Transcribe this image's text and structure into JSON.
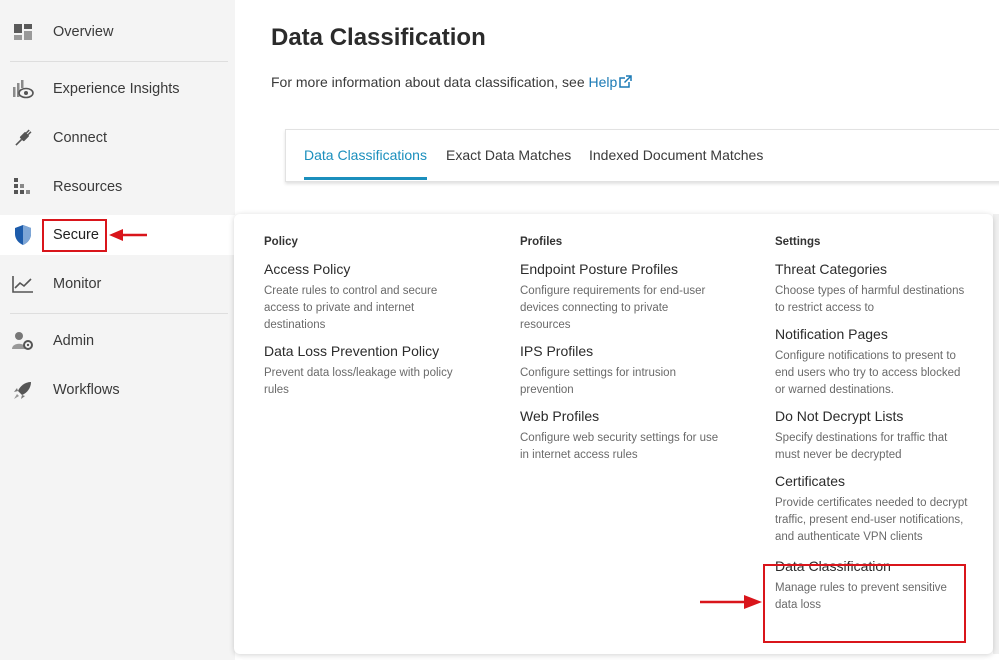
{
  "sidebar": {
    "items": [
      {
        "label": "Overview",
        "icon": "dashboard-icon"
      },
      {
        "label": "Experience Insights",
        "icon": "insights-eye-icon"
      },
      {
        "label": "Connect",
        "icon": "plug-icon"
      },
      {
        "label": "Resources",
        "icon": "resources-grid-icon"
      },
      {
        "label": "Secure",
        "icon": "shield-icon"
      },
      {
        "label": "Monitor",
        "icon": "line-chart-icon"
      },
      {
        "label": "Admin",
        "icon": "user-gear-icon"
      },
      {
        "label": "Workflows",
        "icon": "rocket-icon"
      }
    ],
    "active": "Secure"
  },
  "main": {
    "title": "Data Classification",
    "info_text": "For more information about data classification, see ",
    "help_label": "Help",
    "tabs": [
      {
        "label": "Data Classifications",
        "active": true
      },
      {
        "label": "Exact Data Matches",
        "active": false
      },
      {
        "label": "Indexed Document Matches",
        "active": false
      }
    ]
  },
  "menu": {
    "columns": [
      {
        "heading": "Policy",
        "entries": [
          {
            "title": "Access Policy",
            "desc": "Create rules to control and secure access to private and internet destinations"
          },
          {
            "title": "Data Loss Prevention Policy",
            "desc": "Prevent data loss/leakage with policy rules"
          }
        ]
      },
      {
        "heading": "Profiles",
        "entries": [
          {
            "title": "Endpoint Posture Profiles",
            "desc": "Configure requirements for end-user devices connecting to private resources"
          },
          {
            "title": "IPS Profiles",
            "desc": "Configure settings for intrusion prevention"
          },
          {
            "title": "Web Profiles",
            "desc": "Configure web security settings for use in internet access rules"
          }
        ]
      },
      {
        "heading": "Settings",
        "entries": [
          {
            "title": "Threat Categories",
            "desc": "Choose types of harmful destinations to restrict access to"
          },
          {
            "title": "Notification Pages",
            "desc": "Configure notifications to present to end users who try to access blocked or warned destinations."
          },
          {
            "title": "Do Not Decrypt Lists",
            "desc": "Specify destinations for traffic that must never be decrypted"
          },
          {
            "title": "Certificates",
            "desc": "Provide certificates needed to decrypt traffic, present end-user notifications, and authenticate VPN clients"
          },
          {
            "title": "Data Classification",
            "desc": "Manage rules to prevent sensitive data loss"
          }
        ]
      }
    ]
  },
  "colors": {
    "accent": "#1b8fbd",
    "highlight_box": "#d9151b",
    "shield_blue": "#1d5cab"
  }
}
